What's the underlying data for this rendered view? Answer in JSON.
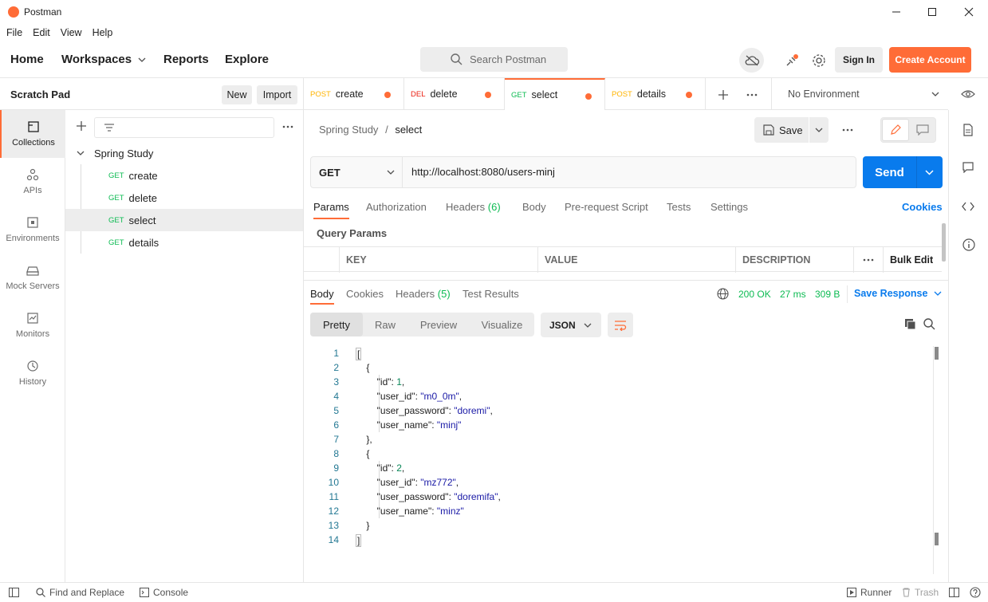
{
  "window": {
    "title": "Postman"
  },
  "menu": [
    "File",
    "Edit",
    "View",
    "Help"
  ],
  "header": {
    "nav": [
      "Home",
      "Workspaces",
      "Reports",
      "Explore"
    ],
    "search_placeholder": "Search Postman",
    "sign_in": "Sign In",
    "create_account": "Create Account",
    "accent": "#ff6c37"
  },
  "scratch": {
    "title": "Scratch Pad",
    "new_label": "New",
    "import_label": "Import"
  },
  "rail": [
    {
      "label": "Collections",
      "icon": "collections-icon"
    },
    {
      "label": "APIs",
      "icon": "apis-icon"
    },
    {
      "label": "Environments",
      "icon": "environments-icon"
    },
    {
      "label": "Mock Servers",
      "icon": "mock-servers-icon"
    },
    {
      "label": "Monitors",
      "icon": "monitors-icon"
    },
    {
      "label": "History",
      "icon": "history-icon"
    }
  ],
  "collection": {
    "name": "Spring Study",
    "requests": [
      {
        "method": "GET",
        "name": "create"
      },
      {
        "method": "GET",
        "name": "delete"
      },
      {
        "method": "GET",
        "name": "select"
      },
      {
        "method": "GET",
        "name": "details"
      }
    ]
  },
  "tabs": [
    {
      "method": "POST",
      "name": "create"
    },
    {
      "method": "DEL",
      "name": "delete"
    },
    {
      "method": "GET",
      "name": "select"
    },
    {
      "method": "POST",
      "name": "details"
    }
  ],
  "environment": "No Environment",
  "request": {
    "breadcrumb_parent": "Spring Study",
    "breadcrumb_sep": "/",
    "breadcrumb_current": "select",
    "save_label": "Save",
    "method": "GET",
    "url": "http://localhost:8080/users-minj",
    "send_label": "Send",
    "tabs": [
      "Params",
      "Authorization",
      "Headers",
      "Body",
      "Pre-request Script",
      "Tests",
      "Settings"
    ],
    "headers_count": "(6)",
    "cookies_label": "Cookies",
    "query_params_label": "Query Params",
    "columns": [
      "KEY",
      "VALUE",
      "DESCRIPTION"
    ],
    "bulk_edit": "Bulk Edit"
  },
  "response": {
    "tabs": [
      "Body",
      "Cookies",
      "Headers",
      "Test Results"
    ],
    "headers_count": "(5)",
    "status": "200 OK",
    "time": "27 ms",
    "size": "309 B",
    "save_response": "Save Response",
    "views": [
      "Pretty",
      "Raw",
      "Preview",
      "Visualize"
    ],
    "format": "JSON",
    "line_numbers": [
      "1",
      "2",
      "3",
      "4",
      "5",
      "6",
      "7",
      "8",
      "9",
      "10",
      "11",
      "12",
      "13",
      "14"
    ]
  },
  "statusbar": {
    "find_replace": "Find and Replace",
    "console": "Console",
    "runner": "Runner",
    "trash": "Trash"
  }
}
